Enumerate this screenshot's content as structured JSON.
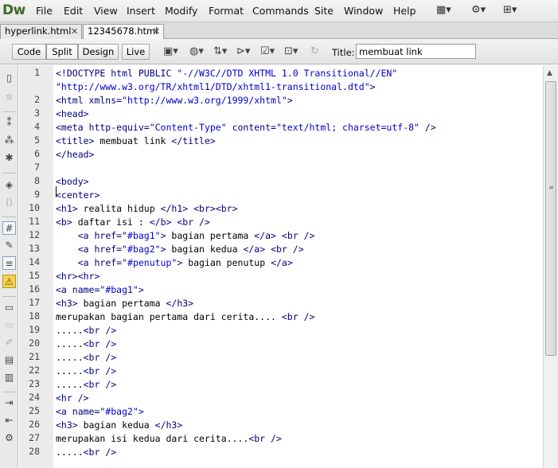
{
  "app": {
    "logo": "Dw"
  },
  "menu": [
    "File",
    "Edit",
    "View",
    "Insert",
    "Modify",
    "Format",
    "Commands",
    "Site",
    "Window",
    "Help"
  ],
  "menu_icons": [
    "layout-icon",
    "gear-icon",
    "sitemap-icon"
  ],
  "tabs": [
    {
      "label": "hyperlink.html",
      "close": "✕"
    },
    {
      "label": "12345678.html",
      "close": "✕"
    }
  ],
  "toolbar": {
    "views": [
      "Code",
      "Split",
      "Design",
      "Live"
    ],
    "active_view": "Split",
    "title_label": "Title:",
    "title_value": "membuat link"
  },
  "editor": {
    "gutter_line_numbers": [
      "1",
      "",
      "2",
      "3",
      "4",
      "5",
      "6",
      "7",
      "8",
      "9",
      "10",
      "11",
      "12",
      "13",
      "14",
      "15",
      "16",
      "17",
      "18",
      "19",
      "20",
      "21",
      "22",
      "23",
      "24",
      "25",
      "26",
      "27",
      "28"
    ],
    "lines": [
      "<!DOCTYPE html PUBLIC \"-//W3C//DTD XHTML 1.0 Transitional//EN\"",
      "\"http://www.w3.org/TR/xhtml1/DTD/xhtml1-transitional.dtd\">",
      "<html xmlns=\"http://www.w3.org/1999/xhtml\">",
      "<head>",
      "<meta http-equiv=\"Content-Type\" content=\"text/html; charset=utf-8\" />",
      "<title> membuat link </title>",
      "</head>",
      "",
      "<body>",
      "<center>",
      "<h1> realita hidup </h1> <br><br>",
      "<b> daftar isi : </b> <br />",
      "    <a href=\"#bag1\"> bagian pertama </a> <br />",
      "    <a href=\"#bag2\"> bagian kedua </a> <br />",
      "    <a href=\"#penutup\"> bagian penutup </a>",
      "<hr><hr>",
      "<a name=\"#bag1\">",
      "<h3> bagian pertama </h3>",
      "merupakan bagian pertama dari cerita.... <br />",
      ".....<br />",
      ".....<br />",
      ".....<br />",
      ".....<br />",
      ".....<br />",
      "<hr />",
      "<a name=\"#bag2\">",
      "<h3> bagian kedua </h3>",
      "merupakan isi kedua dari cerita....<br />",
      ".....<br />"
    ]
  },
  "colors": {
    "tag": "#000080",
    "attr_value": "#0000cc",
    "logo": "#3a6b25",
    "gutter": "#ebebeb"
  }
}
